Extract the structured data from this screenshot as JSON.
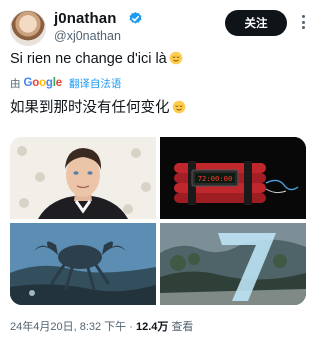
{
  "tweet": {
    "display_name": "j0nathan",
    "handle": "@xj0nathan",
    "follow_label": "关注",
    "text": "Si rien ne change d'ici là",
    "translation_prefix": "由",
    "translation_provider": "Google",
    "translation_link": "翻译自法语",
    "translated_text": "如果到那时没有任何变化",
    "timer_display": "72:00:00",
    "timestamp": "24年4月20日, 8:32 下午 ·",
    "views_count": "12.4万",
    "views_label": "查看"
  },
  "icons": {
    "verified": "verified-badge-icon",
    "more": "more-options-icon",
    "emoji": "relieved-face-emoji"
  },
  "colors": {
    "accent": "#1d9bf0",
    "text_primary": "#0f1419",
    "text_secondary": "#536471",
    "follow_bg": "#0f1419",
    "follow_text": "#ffffff"
  }
}
